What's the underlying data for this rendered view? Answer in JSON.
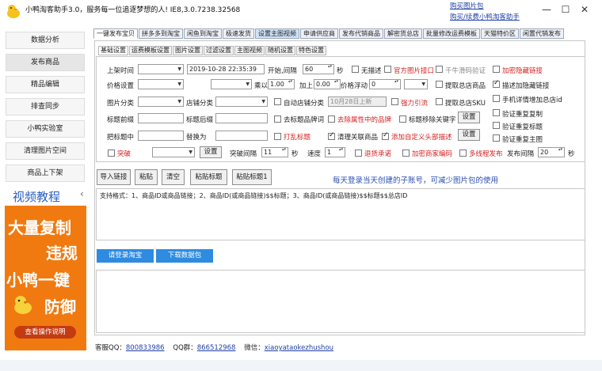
{
  "window": {
    "title": "小鸭淘客助手3.0，服务每一位追逐梦想的人! IE8,3.0.7238.32568",
    "links": [
      "购买图片包",
      "购买/续费小鸭淘客助手"
    ],
    "controls": [
      "—",
      "☐",
      "✕"
    ]
  },
  "sidebar": {
    "items": [
      {
        "label": "数据分析"
      },
      {
        "label": "发布商品",
        "active": true
      },
      {
        "label": "精品编辑"
      },
      {
        "label": "排查同步"
      },
      {
        "label": "小鸭实验室"
      },
      {
        "label": "清理图片空间"
      },
      {
        "label": "商品上下架"
      }
    ],
    "video_label": "视频教程",
    "video_arrow": "‹",
    "ad": {
      "lines": [
        "大量复制",
        "违规",
        "小鸭一键",
        "防御"
      ],
      "button": "查看操作说明",
      "bg_color": "#f07a10"
    }
  },
  "main_tabs": [
    {
      "label": "一键发布宝贝",
      "active": true
    },
    {
      "label": "拼多多到淘宝"
    },
    {
      "label": "闲鱼到淘宝"
    },
    {
      "label": "极速发货"
    },
    {
      "label": "设置主图视频",
      "highlight": true
    },
    {
      "label": "申请供应商"
    },
    {
      "label": "发布代销商品"
    },
    {
      "label": "解密货总店"
    },
    {
      "label": "批量修改运费模板"
    },
    {
      "label": "天猫特价区"
    },
    {
      "label": "闲置代销发布"
    }
  ],
  "sub_tabs": [
    {
      "label": "基础设置",
      "active": true
    },
    {
      "label": "运费模板设置"
    },
    {
      "label": "图片设置"
    },
    {
      "label": "过滤设置"
    },
    {
      "label": "主图视频"
    },
    {
      "label": "随机设置"
    },
    {
      "label": "特色设置"
    }
  ],
  "form": {
    "shelf_time_label": "上架时间",
    "shelf_time_value": "2019-10-28 22:35:39",
    "start_label": "开始,间隔",
    "interval_value": "60",
    "seconds_unit": "秒",
    "no_desc_label": "无描述",
    "official_img_label": "官方图片接口",
    "slider_verify_label": "千牛滑码验证",
    "hidden_link_label": "加密隐藏链接",
    "price_label": "价格设置",
    "multiply_label": "乘以",
    "multiply_value": "1.00",
    "add_label": "加上",
    "add_value": "0.00",
    "price_float_label": "价格浮动",
    "price_float_value": "0",
    "fetch_store_label": "提取总店商品",
    "desc_hidden_label": "描述加隐藏链接",
    "img_category_label": "图片分类",
    "store_category_label": "店铺分类",
    "auto_category_label": "自动店铺分类",
    "date_listed_value": "10月28日上新",
    "strong_traffic_label": "强力引流",
    "fetch_sku_label": "提取总店SKU",
    "phone_desc_label": "手机详情增加总店id",
    "title_prefix_label": "标题前缀",
    "title_suffix_label": "标题后缀",
    "remove_brand_label": "去标题品牌词",
    "remove_attr_brand_label": "去除属性中的品牌",
    "title_remove_kw_label": "标题移除关键字",
    "settings_label": "设置",
    "verify_copy_label": "验证重复复制",
    "title_replace_label": "把标题中",
    "replace_with_label": "替换为",
    "cod_title_label": "打乱标题",
    "clear_related_label": "清理关联商品",
    "custom_header_label": "添加自定义头部描述",
    "verify_title_label": "验证重复标题",
    "verify_main_img_label": "验证重复主图",
    "burst_label": "突破",
    "burst_interval_label": "突破间隔",
    "burst_interval_value": "11",
    "speed_label": "速度",
    "speed_value": "1",
    "refund_label": "退货承诺",
    "merchant_code_label": "加密商家编码",
    "multi_publish_label": "多线程发布",
    "publish_interval_label": "发布间隔",
    "publish_interval_value": "20"
  },
  "actions": {
    "import_label": "导入链接",
    "paste_label": "粘贴",
    "clear_label": "清空",
    "paste_title_label": "粘贴标题",
    "paste_title1_label": "粘贴标题1",
    "notice": "每天登录当天创建的子账号，可减少图片包的使用",
    "format_text": "支持格式：1、商品ID或商品链接；2、商品ID(或商品链接)$$标题；3、商品ID(或商品链接)$$标题$$总店ID",
    "login_label": "请登录淘宝",
    "download_label": "下载数据包"
  },
  "footer": {
    "qq_label": "客服QQ：",
    "qq_value": "800833986",
    "group_label": "QQ群：",
    "group_value": "866512968",
    "wechat_label": "微信：",
    "wechat_value": "xiaoyataokezhushou"
  }
}
